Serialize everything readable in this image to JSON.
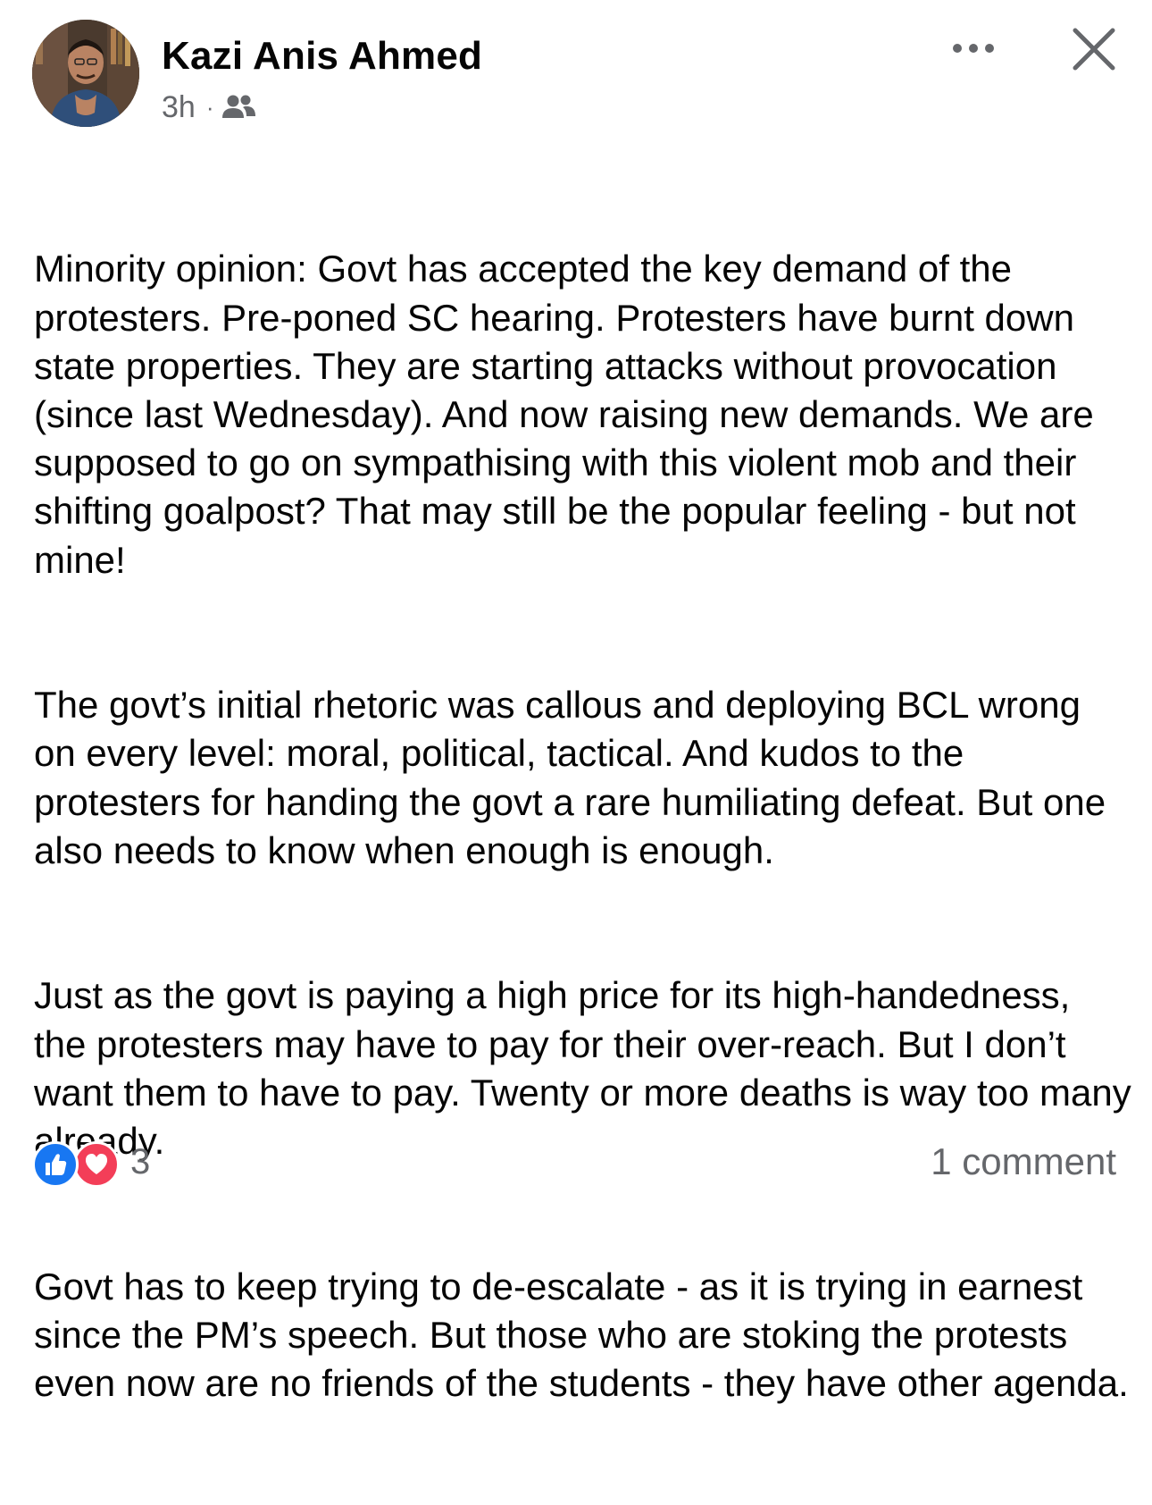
{
  "post": {
    "author": "Kazi Anis Ahmed",
    "time": "3h",
    "separator": "·",
    "audience_icon": "friends-icon",
    "more_icon": "more-horizontal-icon",
    "close_icon": "close-icon",
    "paragraphs": [
      "Minority opinion: Govt has accepted the key demand of the protesters. Pre-poned SC hearing. Protesters have burnt down state properties. They are starting attacks without provocation (since last Wednesday). And now raising new demands. We are supposed to go on sympathising with this violent mob and their shifting goalpost? That may still be the popular feeling - but not mine!",
      "The govt’s initial rhetoric was callous and deploying BCL wrong on every level: moral, political, tactical. And kudos to the protesters for handing the govt a rare humiliating defeat. But one also needs to know when enough is enough.",
      "Just as the govt is paying a high price for its high-handedness, the protesters may have to pay for their over-reach. But I don’t want them to have to pay. Twenty or more deaths is way too many already.",
      "Govt has to keep trying to de-escalate - as it is trying in earnest since the PM’s speech. But those who are stoking the protests even now are no friends of the students - they have other agenda."
    ],
    "reactions": {
      "icons": [
        "like-icon",
        "love-icon"
      ],
      "count": "3"
    },
    "comments_label": "1 comment"
  },
  "colors": {
    "text": "#050505",
    "secondary_text": "#65676b",
    "like_blue": "#1877f2",
    "love_red": "#f33e58"
  }
}
